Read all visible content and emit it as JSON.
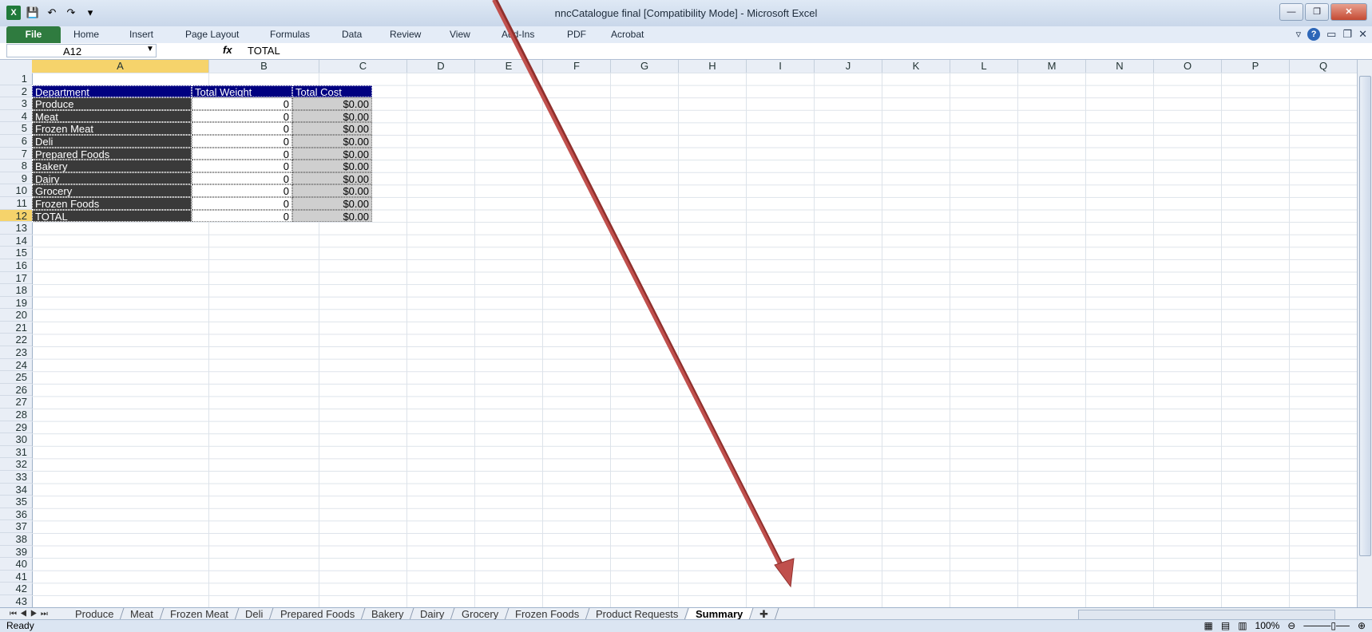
{
  "window": {
    "title": "nncCatalogue final  [Compatibility Mode]  -  Microsoft Excel"
  },
  "ribbon": {
    "file": "File",
    "tabs": [
      "Home",
      "Insert",
      "Page Layout",
      "Formulas",
      "Data",
      "Review",
      "View",
      "Add-Ins",
      "PDF",
      "Acrobat"
    ]
  },
  "formula_bar": {
    "cell_ref": "A12",
    "fx": "fx",
    "content": "TOTAL"
  },
  "columns": [
    "A",
    "B",
    "C",
    "D",
    "E",
    "F",
    "G",
    "H",
    "I",
    "J",
    "K",
    "L",
    "M",
    "N",
    "O",
    "P",
    "Q"
  ],
  "selected_column": "A",
  "selected_row": 12,
  "row_count": 43,
  "table": {
    "headers": [
      "Department",
      "Total Weight",
      "Total Cost"
    ],
    "rows": [
      [
        "Produce",
        "0",
        "$0.00"
      ],
      [
        "Meat",
        "0",
        "$0.00"
      ],
      [
        "Frozen Meat",
        "0",
        "$0.00"
      ],
      [
        "Deli",
        "0",
        "$0.00"
      ],
      [
        "Prepared Foods",
        "0",
        "$0.00"
      ],
      [
        "Bakery",
        "0",
        "$0.00"
      ],
      [
        "Dairy",
        "0",
        "$0.00"
      ],
      [
        "Grocery",
        "0",
        "$0.00"
      ],
      [
        "Frozen Foods",
        "0",
        "$0.00"
      ],
      [
        "TOTAL",
        "0",
        "$0.00"
      ]
    ]
  },
  "sheet_tabs": [
    "Produce",
    "Meat",
    "Frozen Meat",
    "Deli",
    "Prepared Foods",
    "Bakery",
    "Dairy",
    "Grocery",
    "Frozen Foods",
    "Product Requests",
    "Summary"
  ],
  "active_sheet": "Summary",
  "status": {
    "ready": "Ready",
    "zoom": "100%"
  },
  "colors": {
    "header_bg": "#000080",
    "dept_bg": "#3a3a3a",
    "cost_bg": "#cfcfcf",
    "selection": "#f6d36b",
    "arrow": "#c0504d"
  }
}
